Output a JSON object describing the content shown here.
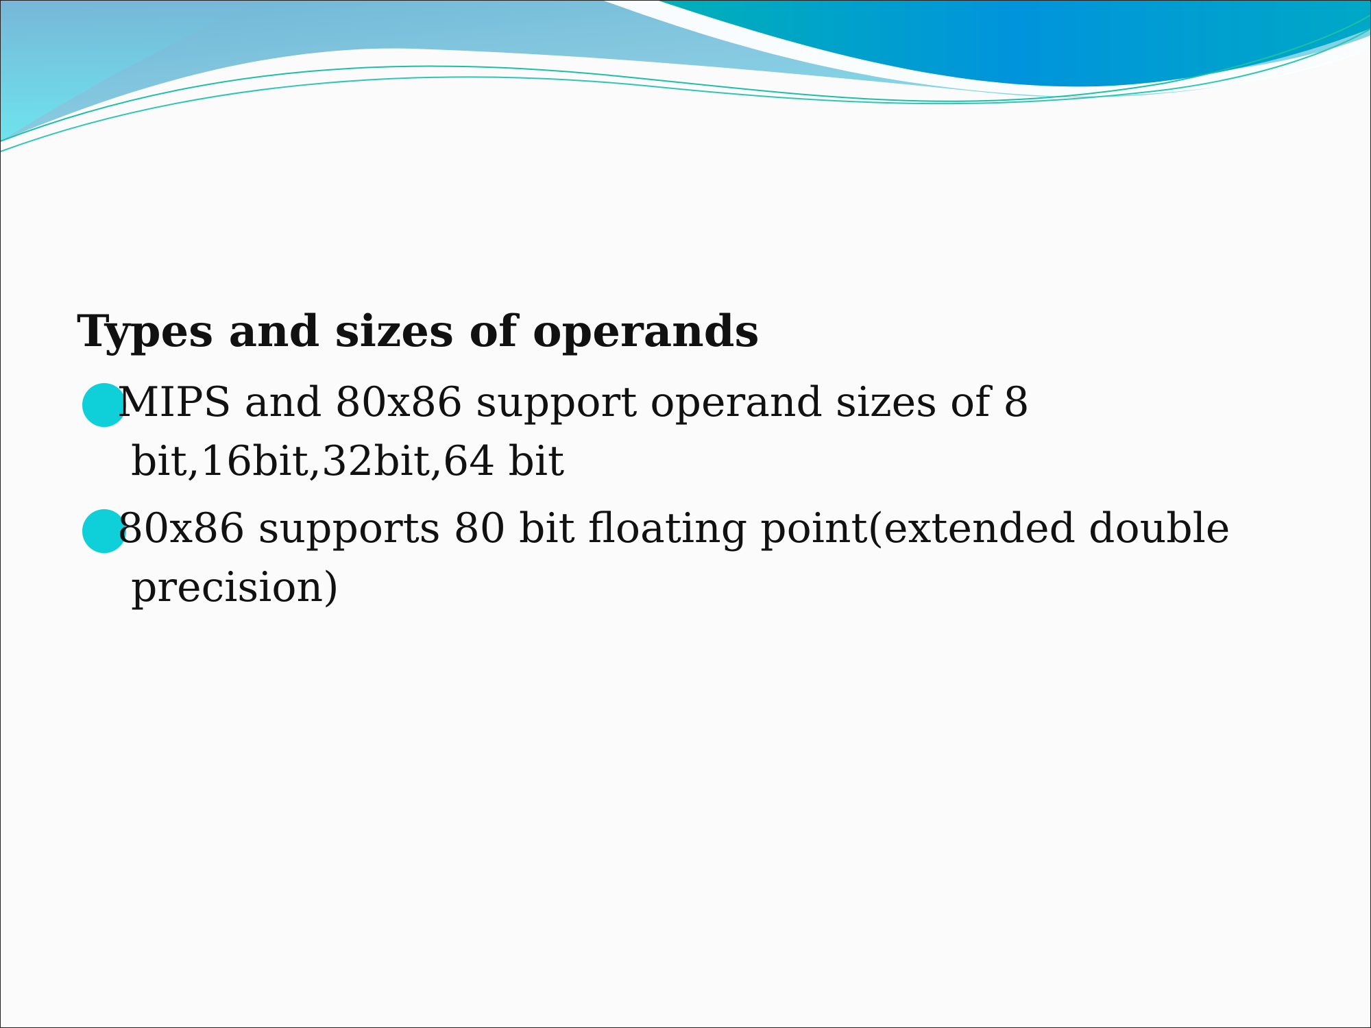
{
  "slide": {
    "heading": "Types and sizes of operands",
    "bullets": [
      {
        "text": "MIPS and 80x86 support operand sizes of 8 bit,16bit,32bit,64 bit"
      },
      {
        "text": "80x86 supports 80 bit floating point(extended double precision)"
      }
    ]
  },
  "colors": {
    "bullet": "#0fcfd9",
    "banner_light": "#7fd3e6",
    "banner_dark": "#0094d9",
    "banner_line": "#1bbfa8"
  }
}
